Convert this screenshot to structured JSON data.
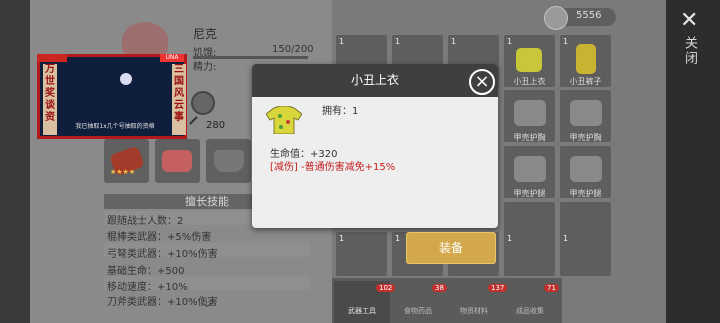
{
  "currency": {
    "amount": "5556"
  },
  "close": {
    "label": "关闭"
  },
  "character": {
    "name": "尼克",
    "hunger_label": "饥饿:",
    "hunger_value": "150/200",
    "stamina_label": "精力:",
    "power": "280"
  },
  "ad": {
    "left_text": "万世奖谈资",
    "right_text": "三国风云事",
    "caption": "我已抽取1x几个号抽取的资格",
    "logo": "UNA"
  },
  "skills": {
    "title": "擅长技能",
    "items": [
      "跟随战士人数：2",
      "棍棒类武器：+5%伤害",
      "弓弩类武器：+10%伤害",
      "基础生命：+500",
      "移动速度：+10%",
      "刀斧类武器：+10%伤害"
    ]
  },
  "inventory": {
    "row0": [
      {
        "count": "1",
        "label": ""
      },
      {
        "count": "1",
        "label": ""
      },
      {
        "count": "1",
        "label": ""
      },
      {
        "count": "1",
        "label": "小丑上衣"
      },
      {
        "count": "1",
        "label": "小丑裤子"
      }
    ],
    "row1_labels": [
      "甲壳护胸",
      "甲壳护胸"
    ],
    "row2_labels": [
      "甲壳护腿",
      "甲壳护腿"
    ],
    "row3_counts": [
      "1",
      "1",
      "1",
      "1",
      "1"
    ]
  },
  "tabs": [
    {
      "label": "武器工具",
      "badge": "102"
    },
    {
      "label": "食物药品",
      "badge": "38"
    },
    {
      "label": "物资材料",
      "badge": "137"
    },
    {
      "label": "成品收集",
      "badge": "71"
    }
  ],
  "dialog": {
    "title": "小丑上衣",
    "owned": "拥有：1",
    "hp": "生命值：+320",
    "reduction": "[减伤] -普通伤害减免+15%",
    "equip_button": "装备"
  },
  "colors": {
    "accent_gold": "#d3a84a",
    "red_text": "#c51f1f",
    "dialog_header": "#3f3f3f"
  }
}
